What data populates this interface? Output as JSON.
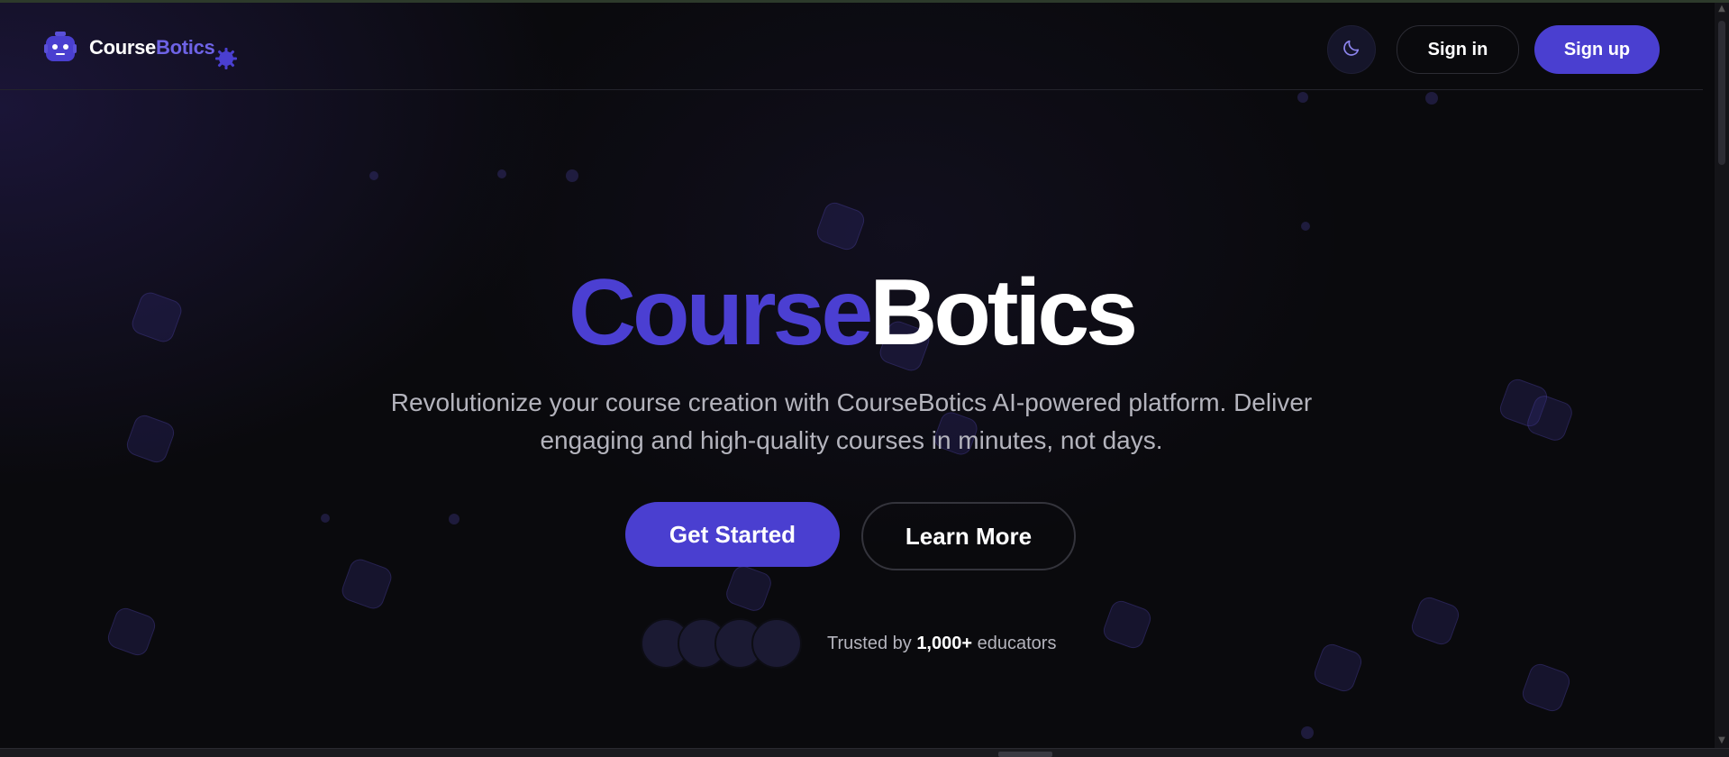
{
  "brand": {
    "name_part1": "Course",
    "name_part2": "Botics",
    "logo_icon": "robot-icon",
    "badge_icon": "gear-badge-icon",
    "color_primary": "#4a3fd0",
    "color_accent": "#6e63e6"
  },
  "header": {
    "theme_toggle_icon": "moon-icon",
    "signin_label": "Sign in",
    "signup_label": "Sign up"
  },
  "hero": {
    "title_part1": "Course",
    "title_part2": "Botics",
    "subtitle_line1": "Revolutionize your course creation with CourseBotics AI-powered platform. Deliver",
    "subtitle_line2": "engaging and high-quality courses in minutes, not days.",
    "primary_cta": "Get Started",
    "secondary_cta": "Learn More",
    "trusted_prefix": "Trusted by",
    "trusted_count": "1,000+",
    "trusted_suffix": "educators",
    "avatar_count": 4
  }
}
